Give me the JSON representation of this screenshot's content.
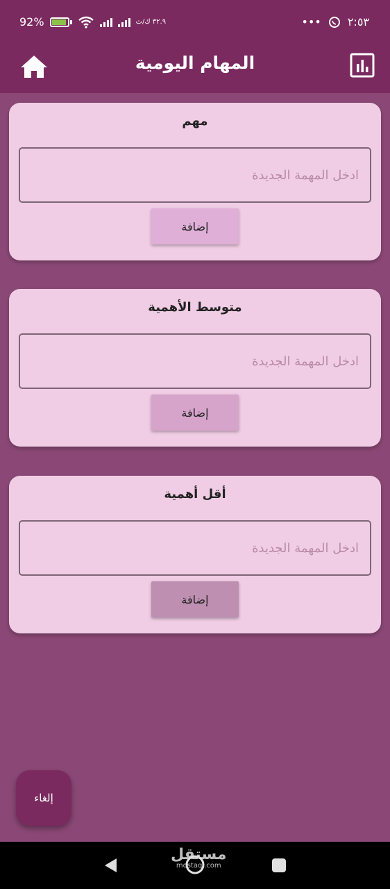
{
  "status_bar": {
    "time": "٢:٥٣",
    "more": "•••",
    "battery": "92%",
    "battery_level": 0.92,
    "network_label": "٣٢.٩ ك/ث"
  },
  "app_bar": {
    "title": "المهام اليومية",
    "left_icon": "home-icon",
    "right_icon": "bar-chart-icon"
  },
  "cards": [
    {
      "title": "مهم",
      "placeholder": "ادخل المهمة الجديدة",
      "button": "إضافة",
      "button_color": "#e0afd8"
    },
    {
      "title": "متوسط الأهمية",
      "placeholder": "ادخل المهمة الجديدة",
      "button": "إضافة",
      "button_color": "#d6a4cb"
    },
    {
      "title": "أقل أهمية",
      "placeholder": "ادخل المهمة الجديدة",
      "button": "إضافة",
      "button_color": "#be8fb1"
    }
  ],
  "fab": {
    "label": "إلغاء"
  },
  "watermark": {
    "main": "مستقل",
    "sub": "mostaql.com"
  },
  "colors": {
    "app_bar": "#7b2a60",
    "background": "#8b4876",
    "card": "#f0cde4"
  }
}
